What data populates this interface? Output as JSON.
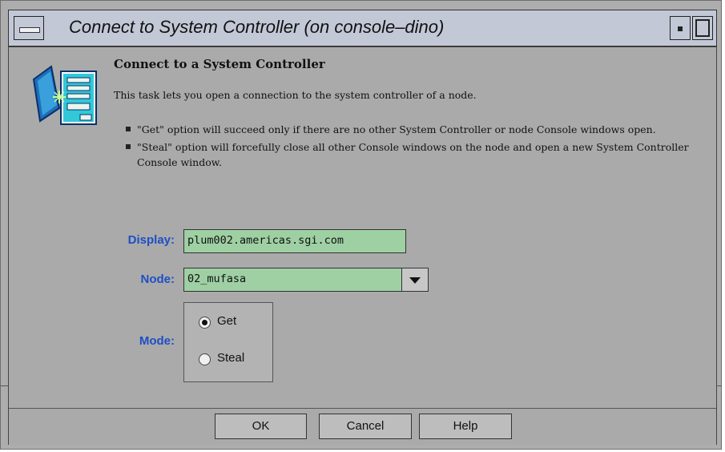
{
  "window": {
    "title": "Connect to System Controller (on console–dino)"
  },
  "icons": {
    "window_menu": "window-menu-icon",
    "minimize": "minimize-icon",
    "maximize": "maximize-icon",
    "task": "system-controller-task-icon",
    "dropdown": "triangle-down-icon",
    "bullet": "square-bullet-icon"
  },
  "colors": {
    "field_bg": "#9ed0a3",
    "label_text": "#1e4fc6",
    "title_bar": "#c2c8d6",
    "panel_bg": "#aaaaaa"
  },
  "task": {
    "heading": "Connect to a System Controller",
    "description": "This task lets you open a connection to the system controller of a node.",
    "bullets": [
      "\"Get\" option will succeed only if there are no other System Controller or node Console windows open.",
      "\"Steal\" option will forcefully close all other Console windows on the node and open a new System Controller Console window."
    ]
  },
  "form": {
    "display_label": "Display:",
    "display_value": "plum002.americas.sgi.com",
    "node_label": "Node:",
    "node_value": "02_mufasa",
    "mode_label": "Mode:",
    "mode_options": [
      {
        "label": "Get",
        "selected": true
      },
      {
        "label": "Steal",
        "selected": false
      }
    ]
  },
  "buttons": {
    "ok": "OK",
    "cancel": "Cancel",
    "help": "Help"
  }
}
